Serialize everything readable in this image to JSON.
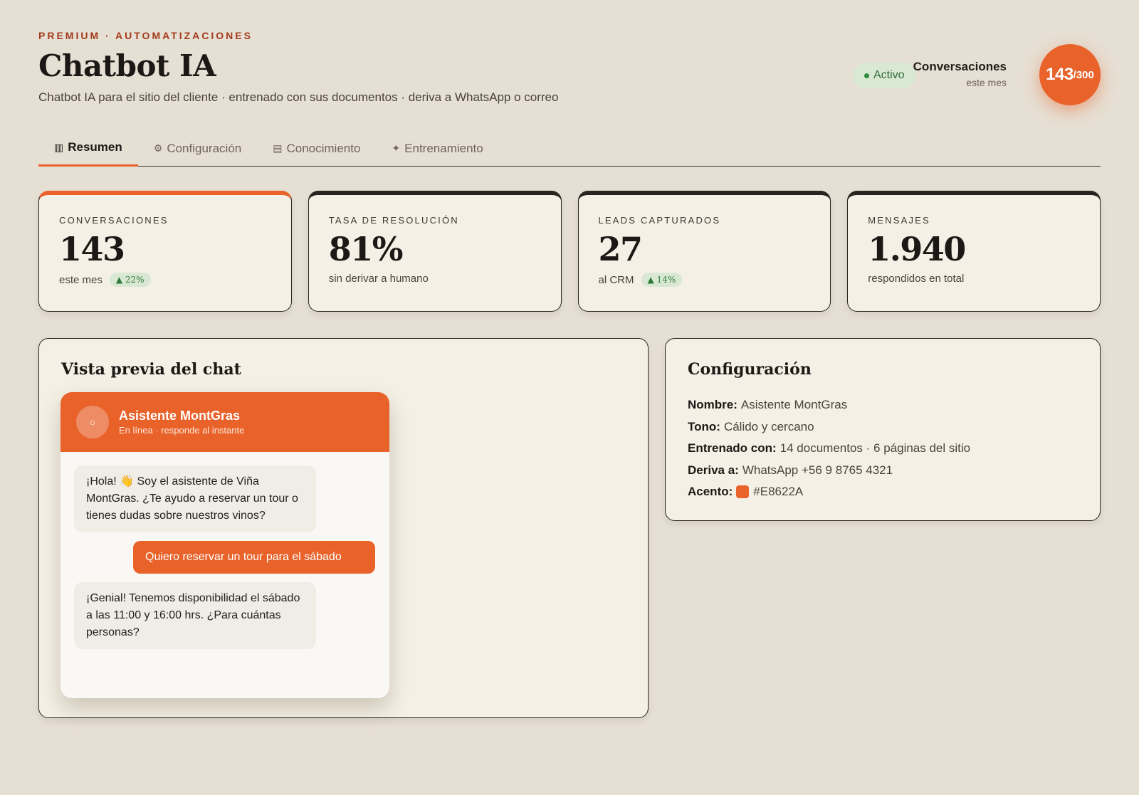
{
  "header": {
    "eyebrow": "PREMIUM · AUTOMATIZACIONES",
    "title": "Chatbot IA",
    "subtitle": "Chatbot IA para el sitio del cliente · entrenado con sus documentos · deriva a WhatsApp o correo",
    "status": "Activo",
    "counter_label": "Conversaciones",
    "counter_sub": "este mes",
    "counter_value": "143",
    "counter_total": "/300"
  },
  "tabs": [
    {
      "icon": "▥",
      "label": "Resumen",
      "active": true
    },
    {
      "icon": "⚙",
      "label": "Configuración",
      "active": false
    },
    {
      "icon": "▤",
      "label": "Conocimiento",
      "active": false
    },
    {
      "icon": "✦",
      "label": "Entrenamiento",
      "active": false
    }
  ],
  "stats": [
    {
      "label": "CONVERSACIONES",
      "value": "143",
      "sub": "este mes",
      "delta": "▲ 22%"
    },
    {
      "label": "TASA DE RESOLUCIÓN",
      "value": "81%",
      "sub": "sin derivar a humano"
    },
    {
      "label": "LEADS CAPTURADOS",
      "value": "27",
      "sub": "al CRM",
      "delta": "▲ 14%"
    },
    {
      "label": "MENSAJES",
      "value": "1.940",
      "sub": "respondidos en total"
    }
  ],
  "chat_preview": {
    "title": "Vista previa del chat",
    "bot_name": "Asistente MontGras",
    "bot_status": "En línea · responde al instante",
    "messages": [
      {
        "from": "bot",
        "text": "¡Hola! 👋 Soy el asistente de Viña MontGras. ¿Te ayudo a reservar un tour o tienes dudas sobre nuestros vinos?"
      },
      {
        "from": "user",
        "text": "Quiero reservar un tour para el sábado"
      },
      {
        "from": "bot",
        "text": "¡Genial! Tenemos disponibilidad el sábado a las 11:00 y 16:00 hrs. ¿Para cuántas personas?"
      }
    ]
  },
  "config": {
    "title": "Configuración",
    "name_key": "Nombre:",
    "name_val": "Asistente MontGras",
    "tone_key": "Tono:",
    "tone_val": "Cálido y cercano",
    "trained_key": "Entrenado con:",
    "trained_val": "14 documentos · 6 páginas del sitio",
    "routes_key": "Deriva a:",
    "routes_val": "WhatsApp +56 9 8765 4321",
    "accent_key": "Acento:",
    "accent_val": "#E8622A"
  },
  "colors": {
    "accent": "#e8622a",
    "background": "#e6dfd3",
    "card": "#f5f0e5",
    "positive": "#2f7a3b"
  }
}
